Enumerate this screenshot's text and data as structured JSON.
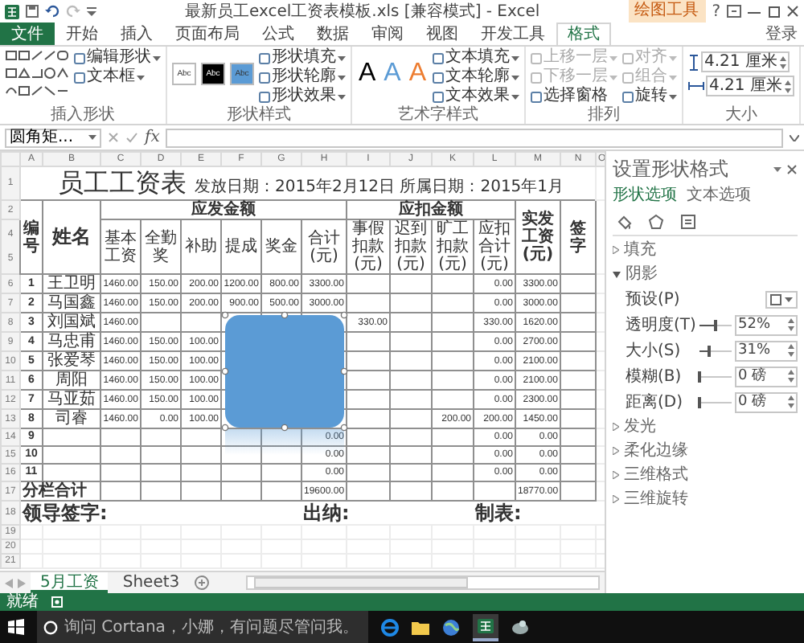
{
  "window": {
    "title": "最新员工excel工资表模板.xls [兼容模式] - Excel",
    "context_tab": "绘图工具",
    "help": "?",
    "sign_in": "登录"
  },
  "ribbon_tabs": [
    {
      "label": "文件",
      "kind": "file",
      "selected": false
    },
    {
      "label": "开始",
      "kind": "tab",
      "selected": false
    },
    {
      "label": "插入",
      "kind": "tab",
      "selected": false
    },
    {
      "label": "页面布局",
      "kind": "tab",
      "selected": false
    },
    {
      "label": "公式",
      "kind": "tab",
      "selected": false
    },
    {
      "label": "数据",
      "kind": "tab",
      "selected": false
    },
    {
      "label": "审阅",
      "kind": "tab",
      "selected": false
    },
    {
      "label": "视图",
      "kind": "tab",
      "selected": false
    },
    {
      "label": "开发工具",
      "kind": "tab",
      "selected": false
    },
    {
      "label": "格式",
      "kind": "tab",
      "selected": true
    }
  ],
  "ribbon_groups": [
    {
      "kind": "shapes",
      "label": "插入形状",
      "buttons": [
        {
          "label": "编辑形状",
          "dropdown": true,
          "disabled": false
        },
        {
          "label": "文本框",
          "dropdown": true,
          "disabled": false
        }
      ]
    },
    {
      "kind": "styles",
      "label": "形状样式",
      "swatches": [
        {
          "text": "Abc",
          "color": "#ffffff"
        },
        {
          "text": "Abc",
          "color": "#000000"
        },
        {
          "text": "Abc",
          "color": "#5b9bd5"
        }
      ],
      "buttons": [
        {
          "label": "形状填充",
          "dropdown": true,
          "disabled": false
        },
        {
          "label": "形状轮廓",
          "dropdown": true,
          "disabled": false
        },
        {
          "label": "形状效果",
          "dropdown": true,
          "disabled": false
        }
      ]
    },
    {
      "kind": "wordart",
      "label": "艺术字样式",
      "letters": [
        {
          "text": "A",
          "color": "#000000"
        },
        {
          "text": "A",
          "color": "#5b9bd5"
        },
        {
          "text": "A",
          "color": "#ed7d31"
        }
      ],
      "buttons": [
        {
          "label": "文本填充",
          "dropdown": true,
          "disabled": false
        },
        {
          "label": "文本轮廓",
          "dropdown": true,
          "disabled": false
        },
        {
          "label": "文本效果",
          "dropdown": true,
          "disabled": false
        }
      ]
    },
    {
      "kind": "arrange",
      "label": "排列",
      "buttons": [
        {
          "label": "上移一层",
          "dropdown": true,
          "disabled": true
        },
        {
          "label": "下移一层",
          "dropdown": true,
          "disabled": true
        },
        {
          "label": "选择窗格",
          "dropdown": false,
          "disabled": false
        },
        {
          "label": "对齐",
          "dropdown": true,
          "disabled": true
        },
        {
          "label": "组合",
          "dropdown": true,
          "disabled": true
        },
        {
          "label": "旋转",
          "dropdown": true,
          "disabled": false
        }
      ]
    },
    {
      "kind": "size",
      "label": "大小",
      "fields": [
        {
          "kind": "height",
          "value": "4.21 厘米"
        },
        {
          "kind": "width",
          "value": "4.21 厘米"
        }
      ]
    }
  ],
  "formula_bar": {
    "name_box": "圆角矩...",
    "function_label": "fx"
  },
  "sheet": {
    "columns": [
      "A",
      "B",
      "C",
      "D",
      "E",
      "F",
      "G",
      "H",
      "I",
      "J",
      "K",
      "L",
      "M",
      "N",
      "O"
    ],
    "title_row": {
      "row_number": "1",
      "title": "员工工资表",
      "subtitle": "发放日期：2015年2月12日 所属日期：2015年1月"
    },
    "header": {
      "row_numbers": [
        "2",
        "4",
        "5"
      ],
      "number": "编号",
      "name": "姓名",
      "earnings": "应发金额",
      "earnings_columns": [
        "基本工资",
        "全勤奖",
        "补助",
        "提成",
        "奖金",
        "合计(元)"
      ],
      "deductions": "应扣金额",
      "deduction_columns": [
        "事假扣款(元)",
        "迟到扣款(元)",
        "旷工扣款(元)",
        "应扣合计(元)"
      ],
      "net_pay": "实发工资(元)",
      "signature": "签字"
    },
    "rows": [
      {
        "row_number": "6",
        "no": "1",
        "name": "王卫明",
        "values": {
          "C": "1460.00",
          "D": "150.00",
          "E": "200.00",
          "F": "1200.00",
          "G": "800.00",
          "H": "3300.00",
          "L": "0.00",
          "M": "3300.00"
        }
      },
      {
        "row_number": "7",
        "no": "2",
        "name": "马国鑫",
        "values": {
          "C": "1460.00",
          "D": "150.00",
          "E": "200.00",
          "F": "900.00",
          "G": "500.00",
          "H": "3000.00",
          "L": "0.00",
          "M": "3000.00"
        }
      },
      {
        "row_number": "8",
        "no": "3",
        "name": "刘国斌",
        "values": {
          "C": "1460.00",
          "I": "330.00",
          "L": "330.00",
          "M": "1620.00"
        }
      },
      {
        "row_number": "9",
        "no": "4",
        "name": "马忠甫",
        "values": {
          "C": "1460.00",
          "D": "150.00",
          "E": "100.00",
          "L": "0.00",
          "M": "2700.00"
        }
      },
      {
        "row_number": "10",
        "no": "5",
        "name": "张爱琴",
        "values": {
          "C": "1460.00",
          "D": "150.00",
          "E": "100.00",
          "L": "0.00",
          "M": "2100.00"
        }
      },
      {
        "row_number": "11",
        "no": "6",
        "name": "周阳",
        "values": {
          "C": "1460.00",
          "D": "150.00",
          "E": "100.00",
          "L": "0.00",
          "M": "2100.00"
        }
      },
      {
        "row_number": "12",
        "no": "7",
        "name": "马亚茹",
        "values": {
          "C": "1460.00",
          "D": "150.00",
          "E": "100.00",
          "L": "0.00",
          "M": "2300.00"
        }
      },
      {
        "row_number": "13",
        "no": "8",
        "name": "司睿",
        "values": {
          "C": "1460.00",
          "D": "0.00",
          "E": "100.00",
          "K": "200.00",
          "L": "200.00",
          "M": "1450.00"
        }
      },
      {
        "row_number": "14",
        "no": "9",
        "values": {
          "H": "0.00",
          "L": "0.00",
          "M": "0.00"
        }
      },
      {
        "row_number": "15",
        "no": "10",
        "values": {
          "H": "0.00",
          "L": "0.00",
          "M": "0.00"
        }
      },
      {
        "row_number": "16",
        "no": "11",
        "values": {
          "H": "0.00",
          "L": "0.00",
          "M": "0.00"
        }
      }
    ],
    "total_row": {
      "row_number": "17",
      "label": "分栏合计",
      "values": {
        "H": "19600.00",
        "M": "18770.00"
      }
    },
    "sign_row": {
      "row_number": "18",
      "items": [
        "领导签字:",
        "出纳:",
        "制表:"
      ]
    },
    "empty_rows": [
      "19",
      "20",
      "21"
    ]
  },
  "shape": {
    "kind": "rounded-rectangle",
    "color": "#5b9bd5",
    "selected": true
  },
  "sheet_tabs": [
    {
      "label": "5月工资",
      "selected": true
    },
    {
      "label": "Sheet3",
      "selected": false
    }
  ],
  "status_bar": {
    "text": "就绪"
  },
  "format_pane": {
    "title": "设置形状格式",
    "tabs": [
      {
        "label": "形状选项",
        "selected": true
      },
      {
        "label": "文本选项",
        "selected": false
      }
    ],
    "sections": [
      {
        "label": "填充",
        "expanded": false
      },
      {
        "label": "阴影",
        "expanded": true,
        "controls": [
          {
            "kind": "preset",
            "label": "预设(P)"
          },
          {
            "kind": "slider",
            "label": "透明度(T)",
            "level": 0.52,
            "value": "52%"
          },
          {
            "kind": "slider",
            "label": "大小(S)",
            "level": 0.31,
            "value": "31%"
          },
          {
            "kind": "slider",
            "label": "模糊(B)",
            "level": 0,
            "value": "0 磅"
          },
          {
            "kind": "slider",
            "label": "距离(D)",
            "level": 0,
            "value": "0 磅"
          }
        ]
      },
      {
        "label": "发光",
        "expanded": false
      },
      {
        "label": "柔化边缘",
        "expanded": false
      },
      {
        "label": "三维格式",
        "expanded": false
      },
      {
        "label": "三维旋转",
        "expanded": false
      }
    ]
  },
  "taskbar": {
    "search_placeholder": "询问 Cortana，小娜，有问题尽管问我。"
  }
}
